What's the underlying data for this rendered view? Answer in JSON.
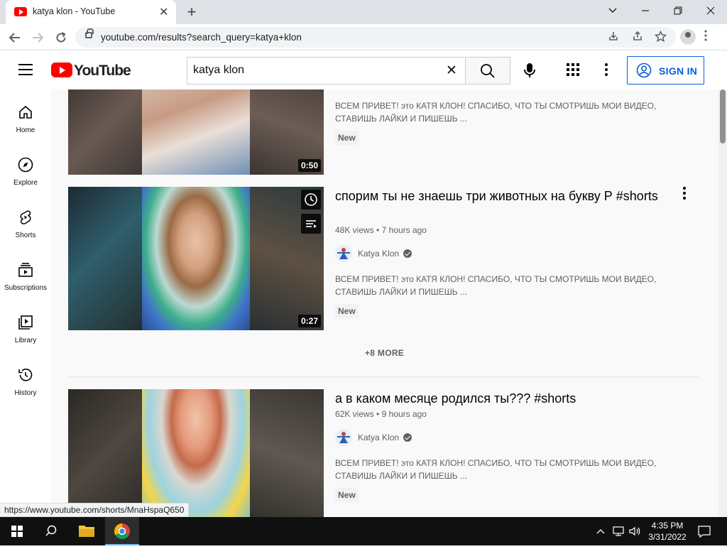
{
  "browser": {
    "tab_title": "katya klon - YouTube",
    "url": "youtube.com/results?search_query=katya+klon",
    "status_url": "https://www.youtube.com/shorts/MnaHspaQ650"
  },
  "youtube": {
    "logo_text": "YouTube",
    "search_query": "katya klon",
    "signin_label": "SIGN IN"
  },
  "guide": [
    {
      "label": "Home",
      "icon": "home-icon"
    },
    {
      "label": "Explore",
      "icon": "compass-icon"
    },
    {
      "label": "Shorts",
      "icon": "shorts-icon"
    },
    {
      "label": "Subscriptions",
      "icon": "subscriptions-icon"
    },
    {
      "label": "Library",
      "icon": "library-icon"
    },
    {
      "label": "History",
      "icon": "history-icon"
    }
  ],
  "results": [
    {
      "duration": "0:50",
      "description": "ВСЕМ ПРИВЕТ! это КАТЯ КЛОН! СПАСИБО, ЧТО ТЫ СМОТРИШЬ МОИ ВИДЕО, СТАВИШЬ ЛАЙКИ И ПИШЕШЬ ...",
      "badge": "New"
    },
    {
      "title": "спорим ты не знаешь три животных на букву Р #shorts",
      "views": "48K views",
      "age": "7 hours ago",
      "channel": "Katya Klon",
      "duration": "0:27",
      "description": "ВСЕМ ПРИВЕТ! это КАТЯ КЛОН! СПАСИБО, ЧТО ТЫ СМОТРИШЬ МОИ ВИДЕО, СТАВИШЬ ЛАЙКИ И ПИШЕШЬ ...",
      "badge": "New"
    },
    {
      "title": "а в каком месяце родился ты??? #shorts",
      "views": "62K views",
      "age": "9 hours ago",
      "channel": "Katya Klon",
      "description": "ВСЕМ ПРИВЕТ! это КАТЯ КЛОН! СПАСИБО, ЧТО ТЫ СМОТРИШЬ МОИ ВИДЕО, СТАВИШЬ ЛАЙКИ И ПИШЕШЬ ...",
      "badge": "New"
    }
  ],
  "more_label": "+8 MORE",
  "taskbar": {
    "time": "4:35 PM",
    "date": "3/31/2022"
  },
  "colors": {
    "accent": "#065fd4",
    "youtube_red": "#ff0000"
  }
}
